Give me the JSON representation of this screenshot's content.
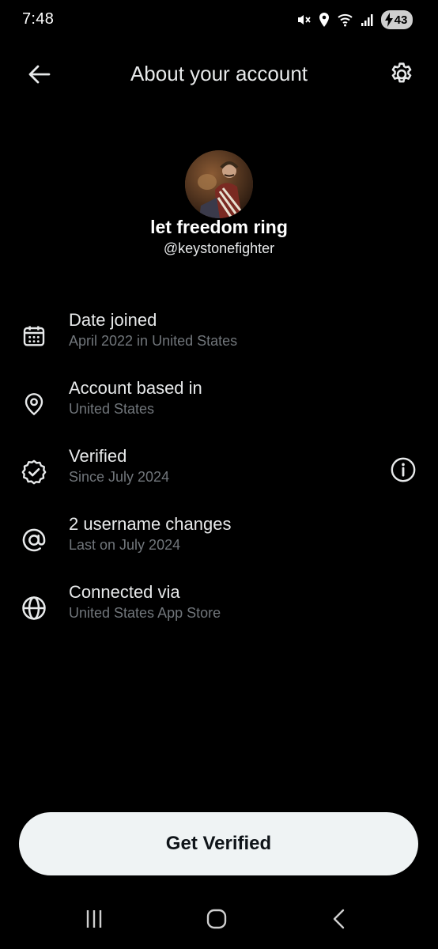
{
  "status_bar": {
    "time": "7:48",
    "battery_level": "43",
    "icons": [
      "mute-icon",
      "location-icon",
      "wifi-icon",
      "signal-icon",
      "battery-icon"
    ]
  },
  "header": {
    "title": "About your account",
    "back_icon": "arrow-left-icon",
    "settings_icon": "gear-icon"
  },
  "profile": {
    "display_name": "let freedom ring",
    "handle": "@keystonefighter"
  },
  "info_rows": [
    {
      "icon": "calendar-icon",
      "title": "Date joined",
      "subtitle": "April 2022 in United States"
    },
    {
      "icon": "location-pin-icon",
      "title": "Account based in",
      "subtitle": "United States"
    },
    {
      "icon": "verified-badge-icon",
      "title": "Verified",
      "subtitle": "Since July 2024",
      "action_icon": "info-icon"
    },
    {
      "icon": "at-sign-icon",
      "title": "2 username changes",
      "subtitle": "Last on July 2024"
    },
    {
      "icon": "globe-icon",
      "title": "Connected via",
      "subtitle": "United States App Store"
    }
  ],
  "primary_button": {
    "label": "Get Verified"
  },
  "nav_bar": {
    "icons": [
      "recents-icon",
      "home-icon",
      "back-icon"
    ]
  },
  "colors": {
    "background": "#000000",
    "primary_text": "#e7e9ea",
    "secondary_text": "#71767b",
    "button_bg": "#eff3f4",
    "button_text": "#0f1419"
  }
}
